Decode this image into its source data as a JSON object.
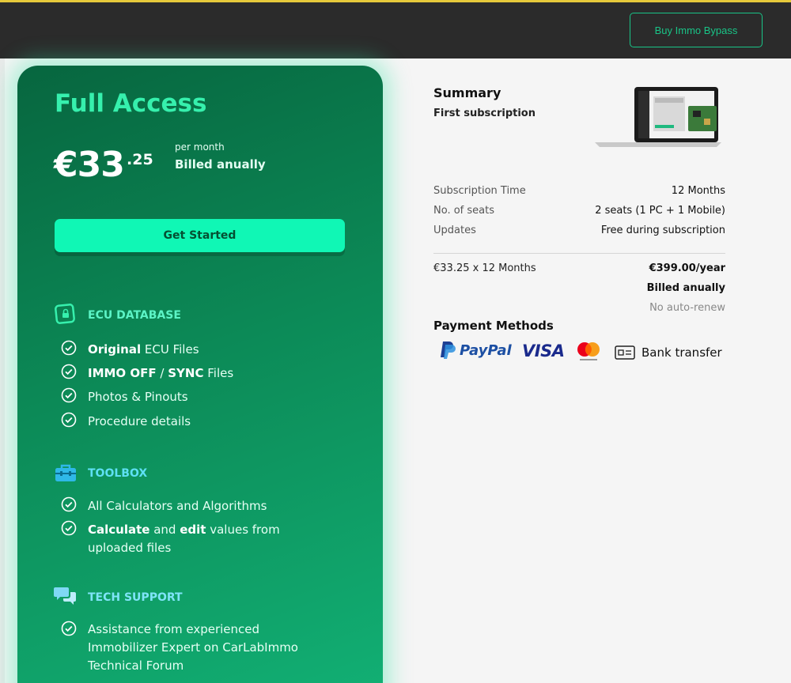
{
  "header": {
    "buy_button_label": "Buy Immo Bypass"
  },
  "plan": {
    "title": "Full Access",
    "price_main": "€33",
    "price_cents": ".25",
    "per_month": "per month",
    "billing": "Billed anually",
    "cta_label": "Get Started"
  },
  "sections": {
    "ecu": {
      "title": "ECU DATABASE",
      "features": [
        {
          "bold": "Original",
          "rest": " ECU Files"
        },
        {
          "bold": "IMMO OFF",
          "mid": " / ",
          "bold2": "SYNC",
          "rest": " Files"
        },
        {
          "rest": "Photos & Pinouts"
        },
        {
          "rest": "Procedure details"
        }
      ]
    },
    "toolbox": {
      "title": "TOOLBOX",
      "features": [
        {
          "rest": "All Calculators and Algorithms"
        },
        {
          "bold": "Calculate",
          "mid": " and ",
          "bold2": "edit",
          "rest": " values from",
          "line2": "uploaded files"
        }
      ]
    },
    "support": {
      "title": "TECH SUPPORT",
      "features": [
        {
          "line1": "Assistance from experienced",
          "line2": "Immobilizer Expert on CarLabImmo",
          "line3": "Technical Forum"
        }
      ]
    }
  },
  "summary": {
    "title": "Summary",
    "subtitle": "First subscription",
    "rows": [
      {
        "label": "Subscription Time",
        "value": "12 Months"
      },
      {
        "label": "No. of seats",
        "value": "2 seats (1 PC + 1 Mobile)"
      },
      {
        "label": "Updates",
        "value": "Free during subscription"
      }
    ],
    "calc": "€33.25 x 12 Months",
    "total": "€399.00/year",
    "billed": "Billed anually",
    "renew": "No auto-renew"
  },
  "payment": {
    "title": "Payment Methods",
    "methods": {
      "paypal": "PayPal",
      "visa": "VISA",
      "bank": "Bank transfer"
    }
  },
  "colors": {
    "accent": "#10f7b5",
    "card_green": "#0c8a57",
    "title_green": "#36f0ad"
  }
}
